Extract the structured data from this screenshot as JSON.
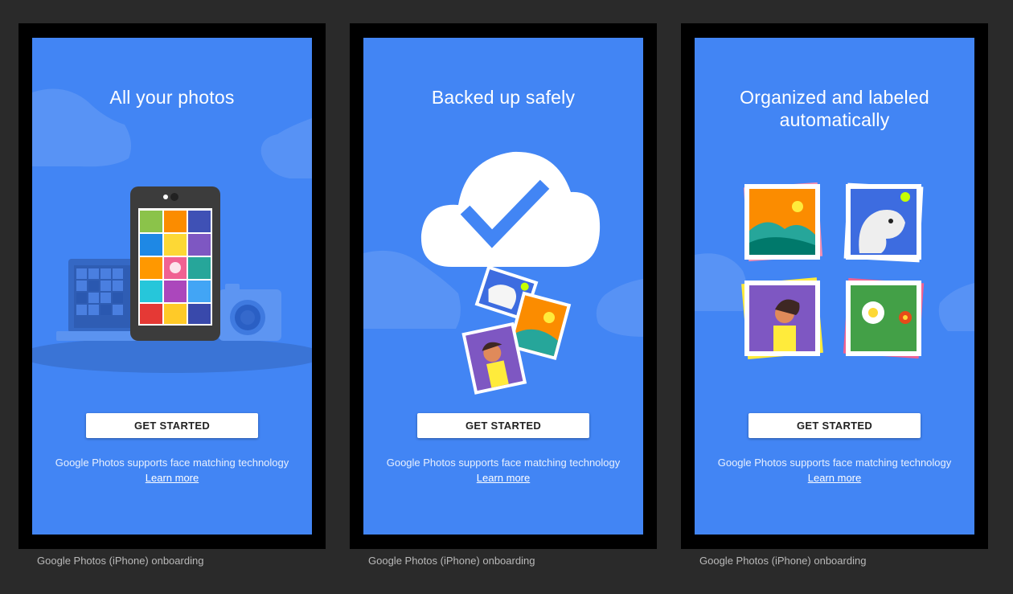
{
  "screens": [
    {
      "title": "All your photos",
      "button_label": "GET STARTED",
      "note_text": "Google Photos supports face matching technology",
      "link_label": "Learn more"
    },
    {
      "title": "Backed up safely",
      "button_label": "GET STARTED",
      "note_text": "Google Photos supports face matching technology",
      "link_label": "Learn more"
    },
    {
      "title": "Organized and labeled automatically",
      "button_label": "GET STARTED",
      "note_text": "Google Photos supports face matching technology",
      "link_label": "Learn more"
    }
  ],
  "captions": [
    "Google Photos (iPhone) onboarding",
    "Google Photos (iPhone) onboarding",
    "Google Photos (iPhone) onboarding"
  ],
  "colors": {
    "screen_bg": "#4285f4",
    "page_bg": "#2a2a2a",
    "button_bg": "#ffffff"
  }
}
